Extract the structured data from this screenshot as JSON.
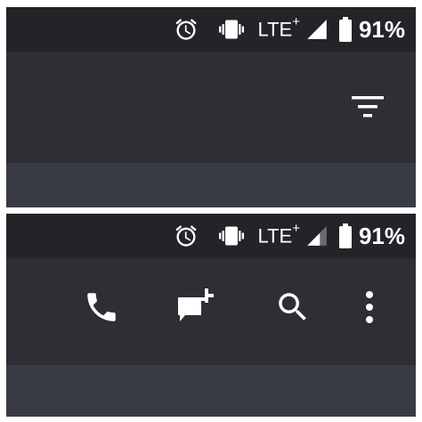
{
  "screens": [
    {
      "status_bar": {
        "alarm_icon": "alarm-clock-icon",
        "vibrate_icon": "vibrate-icon",
        "network_type": "LTE",
        "network_plus": "+",
        "signal_icon": "cell-signal-full-icon",
        "battery_icon": "battery-icon",
        "battery_percent": "91%"
      },
      "toolbar": {
        "filter_icon": "filter-list-icon"
      }
    },
    {
      "status_bar": {
        "alarm_icon": "alarm-clock-icon",
        "vibrate_icon": "vibrate-icon",
        "network_type": "LTE",
        "network_plus": "+",
        "signal_icon": "cell-signal-partial-icon",
        "battery_icon": "battery-icon",
        "battery_percent": "91%"
      },
      "toolbar": {
        "call_icon": "phone-icon",
        "new_message_icon": "add-comment-icon",
        "search_icon": "search-icon",
        "overflow_icon": "more-vert-icon"
      }
    }
  ],
  "colors": {
    "status_bar_bg": "#232428",
    "app_bar_bg": "#2e2f34",
    "strip_bg": "#393b42",
    "icon_color": "#ffffff",
    "signal_dim": "#6b6c70"
  }
}
